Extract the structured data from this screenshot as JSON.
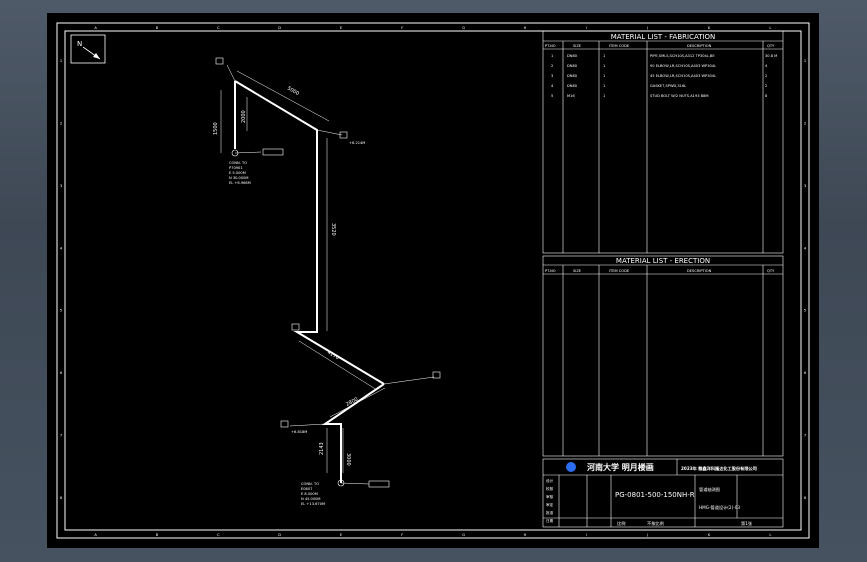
{
  "north_label": "N",
  "column_letters": [
    "A",
    "B",
    "C",
    "D",
    "E",
    "F",
    "G",
    "H",
    "I",
    "J",
    "K",
    "L"
  ],
  "row_numbers": [
    "1",
    "2",
    "3",
    "4",
    "5",
    "6",
    "7",
    "8"
  ],
  "fabrication": {
    "title": "MATERIAL LIST - FABRICATION",
    "headers": [
      "PT.NO",
      "SIZE",
      "ITEM CODE",
      "DESCRIPTION",
      "QTY"
    ],
    "rows": [
      {
        "pt": "1",
        "size": "DN80",
        "code": "1",
        "desc": "PIPE,SMLS,SCH10S,A312 TP304L,BE",
        "qty": "30.8 M"
      },
      {
        "pt": "2",
        "size": "DN80",
        "code": "1",
        "desc": "90 ELBOW,LR,SCH10S,A403 WP304L",
        "qty": "4"
      },
      {
        "pt": "3",
        "size": "DN80",
        "code": "1",
        "desc": "45 ELBOW,LR,SCH10S,A403 WP304L",
        "qty": "2"
      },
      {
        "pt": "4",
        "size": "DN80",
        "code": "1",
        "desc": "GASKET,SPWD,316L",
        "qty": "2"
      },
      {
        "pt": "5",
        "size": "M16",
        "code": "1",
        "desc": "STUD BOLT W/2 NUTS,A193 B8M",
        "qty": "8"
      }
    ]
  },
  "erection": {
    "title": "MATERIAL LIST - ERECTION",
    "headers": [
      "PT.NO",
      "SIZE",
      "ITEM CODE",
      "DESCRIPTION",
      "QTY"
    ]
  },
  "title_block": {
    "university": "河南大学 明月楼画",
    "company": "2023年  赣鑫洋科隆达化工股份有限公司",
    "drawing_no": "PG-0801-500-150NH-R",
    "proj_ref": "HMG-管道设计(2)-03",
    "drawing_name": "管道轴测图",
    "label_scale": "比例",
    "label_sheet": "不按比例",
    "label_sheet_no": "第1张",
    "roles": [
      "设计",
      "校核",
      "审核",
      "审定",
      "批准",
      "日期"
    ]
  },
  "annotations": {
    "top_ends": "+6.214M",
    "conn_upper_1": "CONN. TO",
    "conn_upper_2": "P70901",
    "conn_upper_3": "E 5.000M",
    "conn_upper_4": "N 30.000M",
    "conn_upper_5": "EL +6.966M",
    "mid_elev": "+6.818M",
    "conn_lower_1": "CONN. TO",
    "conn_lower_2": "E0807",
    "conn_lower_3": "E 8.000M",
    "conn_lower_4": "N 45.000M",
    "conn_lower_5": "EL +13.670M",
    "dim_top": "5000",
    "dim_left": "1500",
    "dim_vert": "2000",
    "dim_long": "3520",
    "dim_diag1": "4170",
    "dim_diag2": "2800",
    "dim_low1": "2143",
    "dim_low2": "3000"
  }
}
